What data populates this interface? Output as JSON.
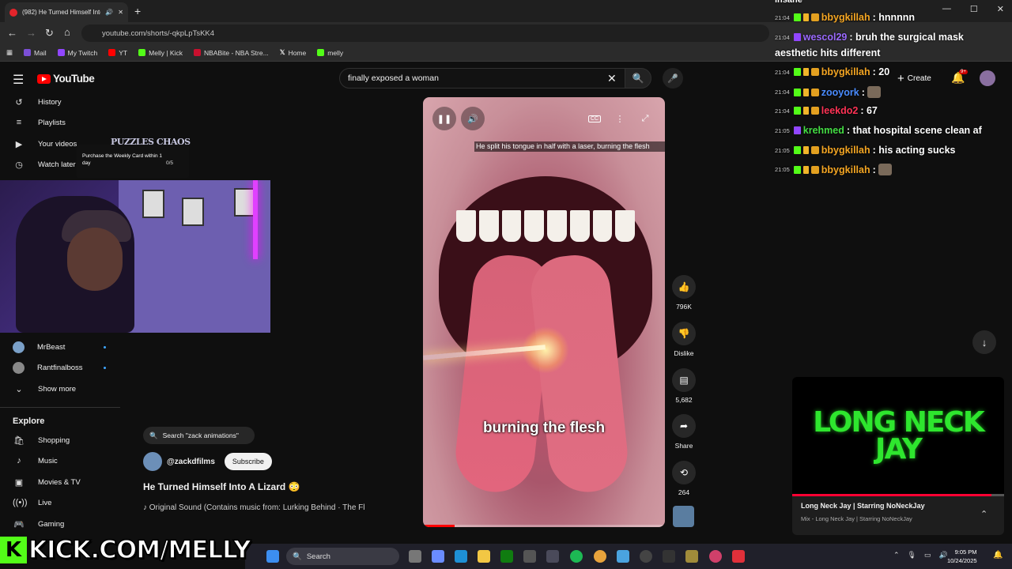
{
  "browser": {
    "tab_title": "(982) He Turned Himself Into",
    "url": "youtube.com/shorts/-qkpLpTsKK4",
    "bookmarks": [
      "Mail",
      "My Twitch",
      "YT",
      "Melly | Kick",
      "NBABite - NBA Stre...",
      "Home",
      "melly"
    ]
  },
  "youtube": {
    "logo": "YouTube",
    "search_value": "finally exposed a woman",
    "create_label": "Create",
    "notif_badge": "9+",
    "sidebar": {
      "top": [
        {
          "label": "History",
          "icon": "history-icon"
        },
        {
          "label": "Playlists",
          "icon": "playlists-icon"
        },
        {
          "label": "Your videos",
          "icon": "your-videos-icon"
        },
        {
          "label": "Watch later",
          "icon": "watch-later-icon"
        }
      ],
      "subs": [
        {
          "label": "MrBeast"
        },
        {
          "label": "Rantfinalboss"
        }
      ],
      "show_more": "Show more",
      "explore_title": "Explore",
      "explore": [
        {
          "label": "Shopping",
          "icon": "shopping-icon"
        },
        {
          "label": "Music",
          "icon": "music-icon"
        },
        {
          "label": "Movies & TV",
          "icon": "movies-icon"
        },
        {
          "label": "Live",
          "icon": "live-icon"
        },
        {
          "label": "Gaming",
          "icon": "gaming-icon"
        }
      ]
    },
    "video": {
      "subtitle_box": "He split his tongue in half with a laser, burning the flesh",
      "caption": "burning the flesh",
      "progress": 0.13,
      "search_chip": "Search \"zack animations\"",
      "channel": "@zackdfilms",
      "subscribe_label": "Subscribe",
      "title": "He Turned Himself Into A Lizard 😳",
      "sound": "♪ Original Sound (Contains music from: Lurking Behind · The Fl"
    },
    "actions": {
      "likes": "796K",
      "dislike": "Dislike",
      "comments": "5,682",
      "share": "Share",
      "remix": "264"
    }
  },
  "overlay": {
    "puzzles_title": "PUZZLES CHAOS",
    "puzzles_text": "Purchase the Weekly Card within 1 day",
    "puzzles_count": "0/5",
    "kick_letter": "K",
    "kick_text": "KICK.COM/MELLY"
  },
  "chat": {
    "top_fragment": "insane",
    "messages": [
      {
        "time": "21:04",
        "platform": "kick",
        "user": "bbygkillah",
        "color": "#f5a623",
        "text": ": hnnnnn"
      },
      {
        "time": "21:04",
        "platform": "twitch",
        "user": "wescol29",
        "color": "#9b6bff",
        "text": ": bruh the surgical mask"
      },
      {
        "time": "",
        "platform": "",
        "user": "",
        "color": "#ffffff",
        "text": "aesthetic hits different"
      },
      {
        "time": "21:04",
        "platform": "kick",
        "user": "bbygkillah",
        "color": "#f5a623",
        "text": ": 20"
      },
      {
        "time": "21:04",
        "platform": "kick",
        "user": "zooyork",
        "color": "#4a8cff",
        "text": ":"
      },
      {
        "time": "21:04",
        "platform": "kick",
        "user": "leekdo2",
        "color": "#ff3355",
        "text": ": 67"
      },
      {
        "time": "21:05",
        "platform": "twitch",
        "user": "krehmed",
        "color": "#44dd44",
        "text": ": that hospital scene clean af"
      },
      {
        "time": "21:05",
        "platform": "kick",
        "user": "bbygkillah",
        "color": "#f5a623",
        "text": ": his acting sucks"
      },
      {
        "time": "21:05",
        "platform": "kick",
        "user": "bbygkillah",
        "color": "#f5a623",
        "text": ":"
      }
    ]
  },
  "now_playing": {
    "art_text": "LONG NECK JAY",
    "title": "Long Neck Jay | Starring NoNeckJay",
    "subtitle": "Mix - Long Neck Jay | Starring NoNeckJay",
    "progress": 0.94
  },
  "taskbar": {
    "search": "Search",
    "time": "9:05 PM",
    "date": "10/24/2025"
  }
}
